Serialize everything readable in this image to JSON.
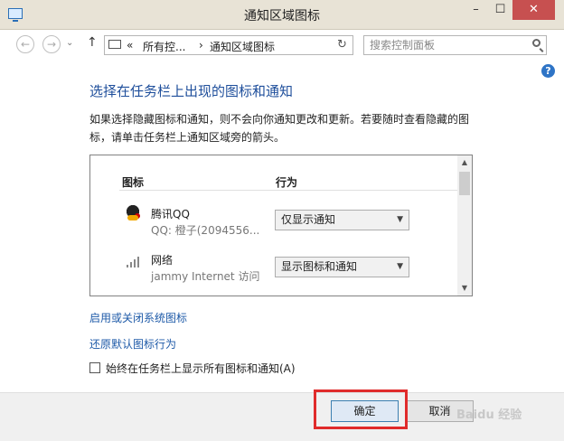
{
  "window": {
    "title": "通知区域图标",
    "minimize": "–",
    "maximize": "☐",
    "close": "✕"
  },
  "nav": {
    "back": "←",
    "forward": "→",
    "history": "⌄",
    "up": "↑",
    "breadcrumb_sep": "«",
    "breadcrumb_1": "所有控...",
    "breadcrumb_arrow": "›",
    "breadcrumb_2": "通知区域图标",
    "dropdown": "⌄",
    "refresh": "↻",
    "search_placeholder": "搜索控制面板"
  },
  "help": "?",
  "main": {
    "heading": "选择在任务栏上出现的图标和通知",
    "description": "如果选择隐藏图标和通知，则不会向你通知更改和更新。若要随时查看隐藏的图标，请单击任务栏上通知区域旁的箭头。"
  },
  "table": {
    "col_icon": "图标",
    "col_behavior": "行为",
    "rows": [
      {
        "icon": "qq-icon",
        "name": "腾讯QQ",
        "sub": "QQ: 橙子(2094556...",
        "behavior": "仅显示通知"
      },
      {
        "icon": "network-icon",
        "name": "网络",
        "sub": "jammy Internet 访问",
        "behavior": "显示图标和通知"
      }
    ],
    "scroll_up": "▲",
    "scroll_down": "▼",
    "select_arrow": "▼"
  },
  "links": {
    "toggle_system_icons": "启用或关闭系统图标",
    "restore_defaults": "还原默认图标行为"
  },
  "checkbox": {
    "label": "始终在任务栏上显示所有图标和通知(A)",
    "checked": false
  },
  "buttons": {
    "ok": "确定",
    "cancel": "取消"
  },
  "watermark": "Baidu 经验",
  "colors": {
    "heading": "#1e4e9b",
    "link": "#1e5aa8",
    "highlight": "#e02b2b"
  }
}
